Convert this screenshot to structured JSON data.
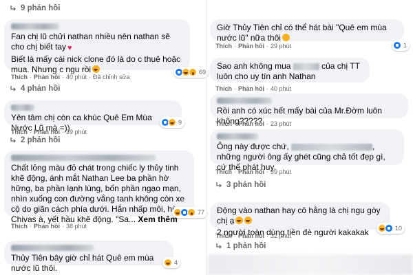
{
  "left": {
    "top_reply_toggle": "9 phản hồi",
    "c1": {
      "text1": "Fan chị lũ chửi nathan nhiều nên nathan sẽ cho chị biết tay",
      "text2": "Biết là mấy cái nick clone đó là do c thuê hoặc mua. Nhưng c ngu rồi",
      "action_like": "Thích",
      "action_reply": "Phản hồi",
      "time": "40 phút",
      "edited": "Đã chỉnh sửa",
      "reaction_count": "69",
      "reply_toggle": "4 phản hồi"
    },
    "c2": {
      "text": "Yên tâm chị còn ca khúc Quê Em Mùa Nước Lũ mà =))",
      "action_like": "Thích",
      "action_reply": "Phản hồi",
      "time": "39 phút",
      "reaction_count": "9",
      "reply_toggle": "2 phản hồi"
    },
    "c3": {
      "text": "Chất lỏng màu đỏ chát trong chiếc ly thủy tinh khẽ động, ánh mắt Nathan Lee ba phần hờ hững, ba phần lạnh lùng, bốn phần ngạo mạn, nhìn xuống con đường vắng tanh không còn xe cộ do giãn cách phía dưới. Hắn nhấp môi, hừm, Chivas à, yết hầu khẽ động. \"Sa...",
      "see_more": "Xem thêm",
      "action_like": "Thích",
      "action_reply": "Phản hồi",
      "time": "38 phút",
      "reaction_count": "77"
    },
    "c4": {
      "text": "Thủy Tiên bây giờ chỉ hát Quê em mùa nước lũ thôi.",
      "reaction_count": "4"
    }
  },
  "right": {
    "c1": {
      "text": "Giờ Thủy Tiên chỉ có thể hát bài \"Quê em mùa nước lũ\" nữa thôi",
      "action_like": "Thích",
      "action_reply": "Phản hồi",
      "time": "29 phút",
      "reaction_count": "1"
    },
    "c2": {
      "text_a": "Sao anh không mua",
      "text_b": "của chị TT luôn cho uy tín anh Nathan",
      "action_like": "Thích",
      "action_reply": "Phản hồi",
      "time": "40 phút"
    },
    "c3": {
      "text": "Rồi anh có xúc hết mấy bài của Mr.Đờm luôn không?????",
      "action_like": "Thích",
      "action_reply": "Phản hồi",
      "time": "23 phút"
    },
    "c4": {
      "text_a": "Ông này được chứ,",
      "text_b": ", những người ông ấy ghét cũng chả tốt đẹp gì, cứ thế phát huy.",
      "action_like": "Thích",
      "action_reply": "Phản hồi",
      "time": "39 phút",
      "reply_toggle": "3 phản hồi"
    },
    "c5": {
      "text1": "Động vào nathan hay cô hằng là chị ngu gòy chị ạ",
      "text2": "2 người toàn dùng tiền đè người kakakak",
      "action_like": "Thích",
      "action_reply": "Phản hồi",
      "time": "32 phút",
      "reaction_count": "10",
      "reply_toggle": "1 phản hồi"
    }
  }
}
